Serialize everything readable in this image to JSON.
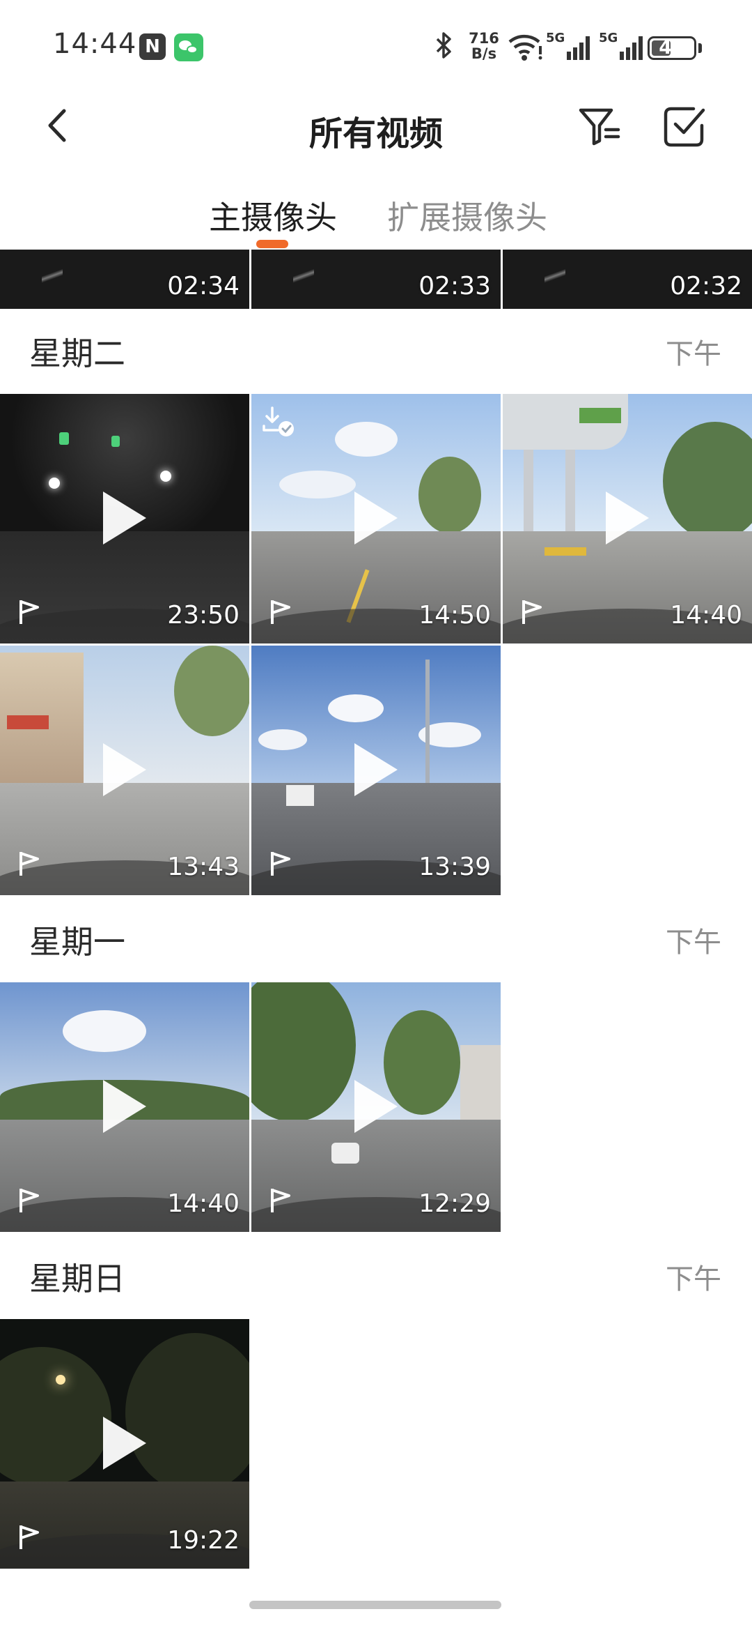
{
  "status_bar": {
    "time": "14:44",
    "nfc_icon": "N",
    "net_speed_value": "716",
    "net_speed_unit": "B/s",
    "signal1_label": "5G",
    "signal2_label": "5G",
    "battery_text": "46",
    "battery_level": 0.46
  },
  "header": {
    "title": "所有视频"
  },
  "tabs": [
    {
      "label": "主摄像头",
      "active": true
    },
    {
      "label": "扩展摄像头",
      "active": false
    }
  ],
  "top_partial_row": [
    {
      "duration": "02:34"
    },
    {
      "duration": "02:33"
    },
    {
      "duration": "02:32"
    }
  ],
  "groups": [
    {
      "day": "星期二",
      "period": "下午",
      "videos": [
        {
          "duration": "23:50",
          "scene": "tunnel",
          "downloaded": false
        },
        {
          "duration": "14:50",
          "scene": "road-sky",
          "downloaded": true
        },
        {
          "duration": "14:40",
          "scene": "toll",
          "downloaded": false
        },
        {
          "duration": "13:43",
          "scene": "street",
          "downloaded": false
        },
        {
          "duration": "13:39",
          "scene": "bridge",
          "downloaded": false
        }
      ]
    },
    {
      "day": "星期一",
      "period": "下午",
      "videos": [
        {
          "duration": "14:40",
          "scene": "highway",
          "downloaded": false
        },
        {
          "duration": "12:29",
          "scene": "trees",
          "downloaded": false
        }
      ]
    },
    {
      "day": "星期日",
      "period": "下午",
      "videos": [
        {
          "duration": "19:22",
          "scene": "night",
          "downloaded": false
        }
      ]
    }
  ],
  "colors": {
    "accent": "#f06a2a",
    "inactive_text": "#8d8d8d"
  },
  "icons": {
    "back": "chevron-left-icon",
    "filter": "filter-icon",
    "select": "checkbox-icon",
    "play": "play-icon",
    "flag": "flag-icon",
    "download_done": "download-done-icon"
  }
}
